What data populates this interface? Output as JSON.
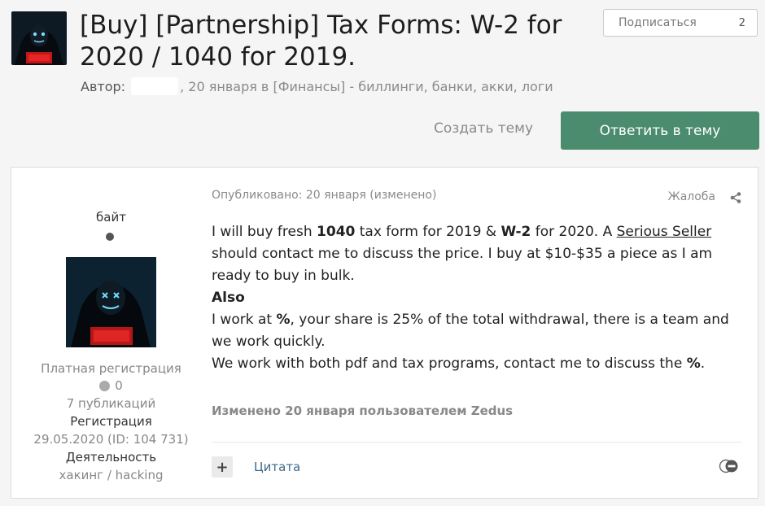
{
  "topic": {
    "title": "[Buy] [Partnership] Tax Forms: W-2 for 2020 / 1040 for 2019.",
    "author_label": "Автор:",
    "byline_rest": ", 20 января в [Финансы] - биллинги, банки, акки, логи"
  },
  "follow": {
    "label": "Подписаться",
    "count": "2"
  },
  "actions": {
    "create_topic": "Создать тему",
    "reply": "Ответить в тему"
  },
  "author": {
    "name": "байт",
    "group": "Платная регистрация",
    "reputation": "0",
    "posts": "7 публикаций",
    "registration_label": "Регистрация",
    "registration_value": "29.05.2020 (ID: 104 731)",
    "activity_label": "Деятельность",
    "activity_value": "хакинг / hacking"
  },
  "post": {
    "posted": "Опубликовано: 20 января (изменено)",
    "report": "Жалоба",
    "p1_a": "I will buy fresh ",
    "p1_b": "1040",
    "p1_c": " tax form for 2019 & ",
    "p1_d": "W-2",
    "p1_e": " for 2020. A ",
    "p1_f": "Serious Seller",
    "p1_g": " should contact me to discuss the price. I buy at $10-$35 a piece as I am ready to buy in bulk.",
    "p2": "Also",
    "p3_a": "I work at ",
    "p3_b": "%",
    "p3_c": ", your share is 25% of the total withdrawal, there is a team and we work quickly.",
    "p4_a": "We work with both pdf and tax programs, contact me to discuss the ",
    "p4_b": "%",
    "p4_c": ".",
    "edited": "Изменено 20 января пользователем Zedus",
    "plus": "+",
    "quote": "Цитата"
  },
  "icons": [
    "hooded-avatar-icon",
    "online-status-icon",
    "reputation-icon",
    "share-icon",
    "reaction-icon",
    "add-multiquote-icon"
  ],
  "colors": {
    "reply_button": "#4a8c6d",
    "background": "#f5f5f5",
    "link": "#3d6b8a"
  }
}
